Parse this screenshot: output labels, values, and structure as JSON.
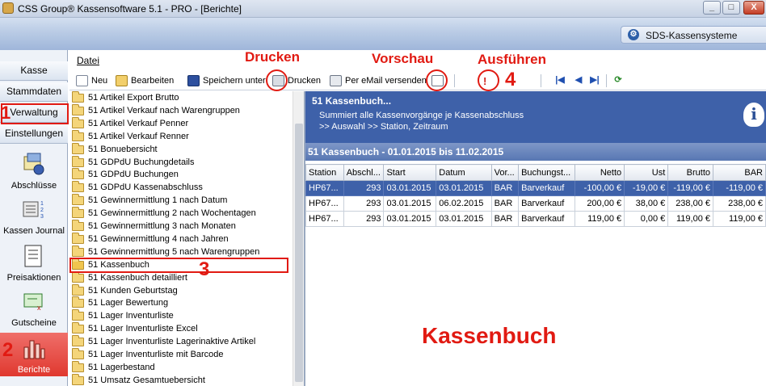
{
  "window": {
    "title": "CSS Group® Kassensoftware 5.1 - PRO - [Berichte]",
    "minimize": "_",
    "maximize": "□",
    "close": "X"
  },
  "brand": {
    "text": "SDS-Kassensysteme",
    "icon": "gear-icon"
  },
  "nav": {
    "buttons": [
      "Kasse",
      "Stammdaten",
      "Verwaltung",
      "Einstellungen"
    ],
    "tiles": [
      {
        "label": "Abschlüsse",
        "icon": "closing-icon"
      },
      {
        "label": "Kassen Journal",
        "icon": "journal-icon"
      },
      {
        "label": "Preisaktionen",
        "icon": "price-action-icon"
      },
      {
        "label": "Gutscheine",
        "icon": "voucher-icon"
      },
      {
        "label": "Berichte",
        "icon": "reports-chart-icon"
      }
    ]
  },
  "menu": {
    "datei": "Datei"
  },
  "toolbar": {
    "neu": "Neu",
    "bearbeiten": "Bearbeiten",
    "speichern": "Speichern unter",
    "drucken": "Drucken",
    "email": "Per eMail versenden"
  },
  "annotations": {
    "drucken": "Drucken",
    "vorschau": "Vorschau",
    "ausfuehren": "Ausführen",
    "n1": "1",
    "n2": "2",
    "n3": "3",
    "n4": "4",
    "caption": "Kassenbuch"
  },
  "reports": [
    "51 Artikel Export Brutto",
    "51 Artikel Verkauf nach Warengruppen",
    "51 Artikel Verkauf Penner",
    "51 Artikel Verkauf Renner",
    "51 Bonuebersicht",
    "51 GDPdU Buchungdetails",
    "51 GDPdU Buchungen",
    "51 GDPdU Kassenabschluss",
    "51 Gewinnermittlung 1 nach Datum",
    "51 Gewinnermittlung 2 nach Wochentagen",
    "51 Gewinnermittlung 3 nach Monaten",
    "51 Gewinnermittlung 4 nach Jahren",
    "51 Gewinnermittlung 5 nach Warengruppen",
    "51 Kassenbuch",
    "51 Kassenbuch detailliert",
    "51 Kunden Geburtstag",
    "51 Lager Bewertung",
    "51 Lager Inventurliste",
    "51 Lager Inventurliste Excel",
    "51 Lager Inventurliste Lagerinaktive Artikel",
    "51 Lager Inventurliste mit Barcode",
    "51 Lagerbestand",
    "51 Umsatz Gesamtuebersicht"
  ],
  "report": {
    "title": "51 Kassenbuch...",
    "description": "Summiert alle Kassenvorgänge je Kassenabschluss",
    "path": ">> Auswahl >> Station, Zeitraum",
    "subheader": "51 Kassenbuch - 01.01.2015 bis 11.02.2015",
    "columns": [
      "Station",
      "Abschl...",
      "Start",
      "Datum",
      "Vor...",
      "Buchungst...",
      "Netto",
      "Ust",
      "Brutto",
      "BAR"
    ],
    "rows": [
      [
        "HP67...",
        "293",
        "03.01.2015",
        "03.01.2015",
        "BAR",
        "Barverkauf",
        "-100,00 €",
        "-19,00 €",
        "-119,00 €",
        "-119,00 €"
      ],
      [
        "HP67...",
        "293",
        "03.01.2015",
        "06.02.2015",
        "BAR",
        "Barverkauf",
        "200,00 €",
        "38,00 €",
        "238,00 €",
        "238,00 €"
      ],
      [
        "HP67...",
        "293",
        "03.01.2015",
        "03.01.2015",
        "BAR",
        "Barverkauf",
        "119,00 €",
        "0,00 €",
        "119,00 €",
        "119,00 €"
      ]
    ]
  }
}
